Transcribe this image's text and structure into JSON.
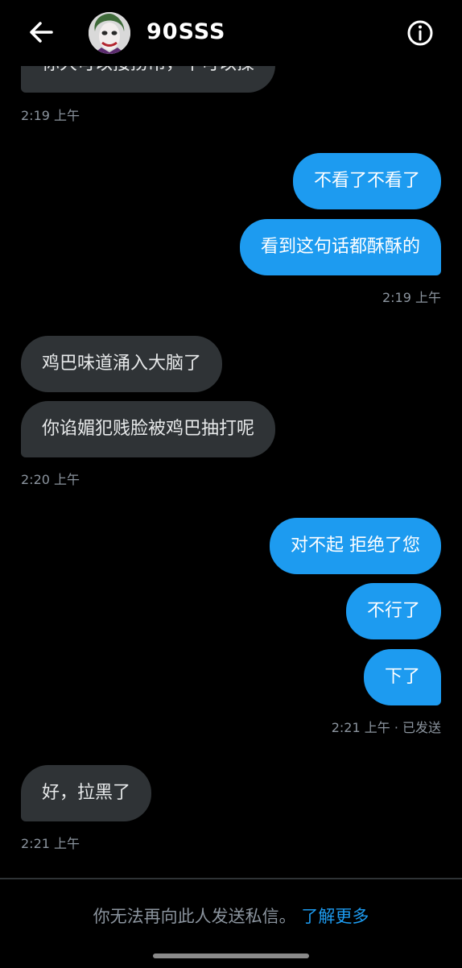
{
  "header": {
    "title": "90SSS",
    "back_icon": "arrow-left-icon",
    "info_icon": "info-circle-icon"
  },
  "messages": [
    {
      "dir": "in",
      "text": "你大可以接捞吊，不可以操"
    },
    {
      "ts": "2:19 上午"
    },
    {
      "dir": "out",
      "text": "不看了不看了"
    },
    {
      "dir": "out",
      "text": "看到这句话都酥酥的"
    },
    {
      "ts": "2:19 上午"
    },
    {
      "dir": "in",
      "text": "鸡巴味道涌入大脑了"
    },
    {
      "dir": "in",
      "text": "你谄媚犯贱脸被鸡巴抽打呢"
    },
    {
      "ts": "2:20 上午"
    },
    {
      "dir": "out",
      "text": "对不起 拒绝了您"
    },
    {
      "dir": "out",
      "text": "不行了"
    },
    {
      "dir": "out",
      "text": "下了"
    },
    {
      "ts": "2:21 上午 · 已发送"
    },
    {
      "dir": "in",
      "text": "好，拉黑了"
    },
    {
      "ts": "2:21 上午"
    }
  ],
  "footer": {
    "notice": "你无法再向此人发送私信。",
    "link": "了解更多"
  },
  "colors": {
    "background": "#000000",
    "incoming_bubble": "#2f3336",
    "outgoing_bubble": "#1d9bf0",
    "timestamp": "#8b949e"
  }
}
